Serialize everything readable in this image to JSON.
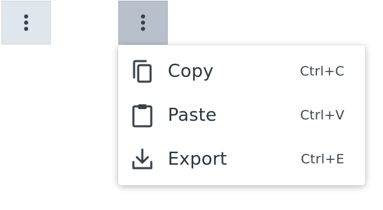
{
  "buttons": [
    {
      "icon": "more-vertical-icon",
      "state": "default"
    },
    {
      "icon": "more-vertical-icon",
      "state": "pressed"
    }
  ],
  "menu": {
    "items": [
      {
        "label": "Copy",
        "shortcut": "Ctrl+C",
        "icon": "copy-icon"
      },
      {
        "label": "Paste",
        "shortcut": "Ctrl+V",
        "icon": "clipboard-icon"
      },
      {
        "label": "Export",
        "shortcut": "Ctrl+E",
        "icon": "download-icon"
      }
    ]
  },
  "colors": {
    "button_bg": "#dfe6ec",
    "button_active_bg": "#b8c1cb",
    "text": "#2b3640",
    "menu_bg": "#ffffff"
  }
}
